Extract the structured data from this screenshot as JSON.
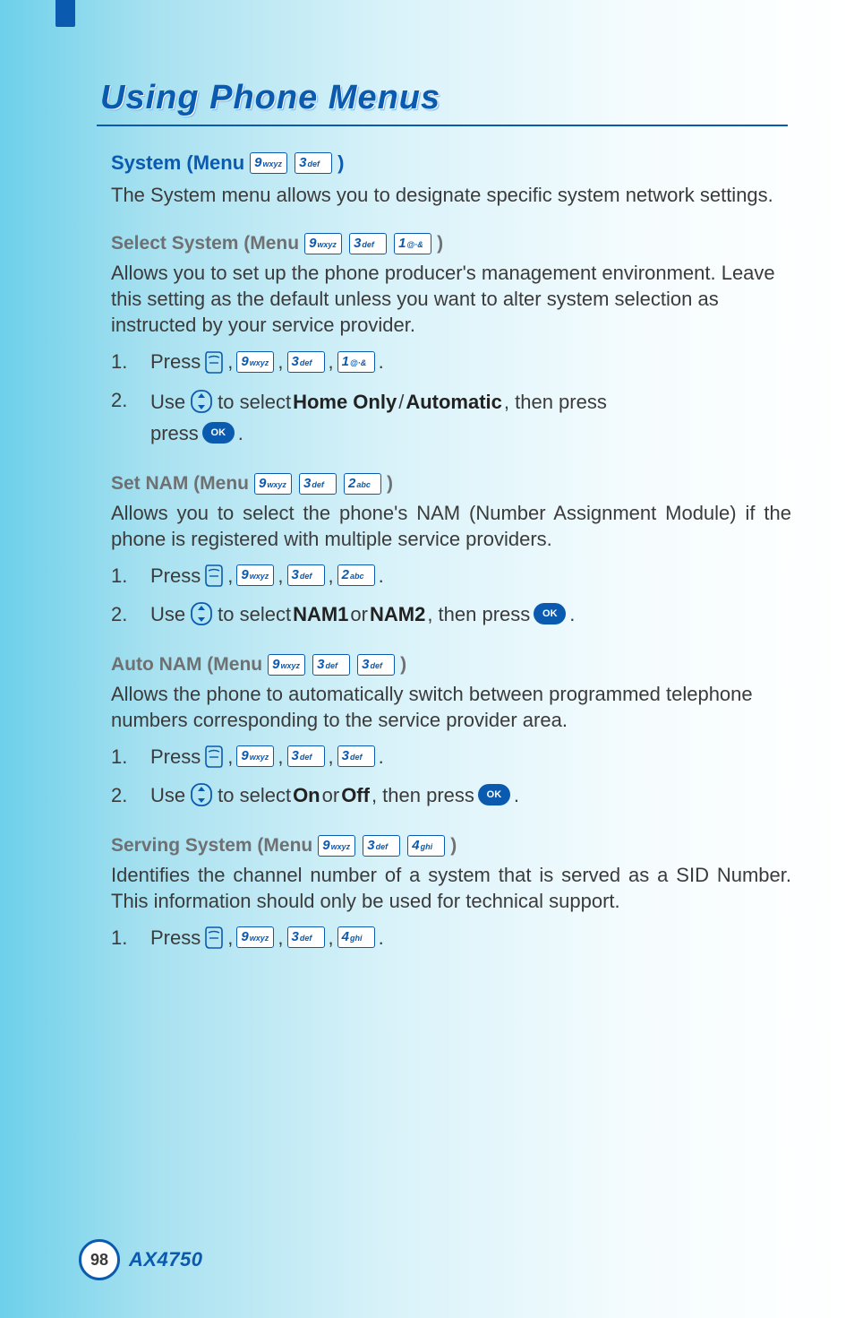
{
  "chapter_title": "Using Phone Menus",
  "keys": {
    "9": {
      "big": "9",
      "sm": "wxyz"
    },
    "3": {
      "big": "3",
      "sm": "def"
    },
    "1": {
      "big": "1",
      "sm": "@·&"
    },
    "2": {
      "big": "2",
      "sm": "abc"
    },
    "4": {
      "big": "4",
      "sm": "ghi"
    }
  },
  "ok_label": "OK",
  "sections": {
    "system": {
      "heading_prefix": "System (Menu ",
      "heading_suffix": ")",
      "description": "The System menu allows you to designate specific system network settings."
    },
    "select_system": {
      "heading_prefix": "Select System (Menu ",
      "heading_suffix": ")",
      "description": "Allows you to set up the phone producer's management environment. Leave this setting as the default unless you want to alter system selection as instructed by your service provider.",
      "step1_prefix": "Press ",
      "step2_prefix": "Use ",
      "step2_mid_a": " to select ",
      "step2_opt1": "Home Only",
      "step2_slash": "/ ",
      "step2_opt2": "Automatic",
      "step2_mid_b": ", then press ",
      "step_end": "."
    },
    "set_nam": {
      "heading_prefix": "Set NAM (Menu ",
      "heading_suffix": ")",
      "description": "Allows you to select the phone's NAM (Number Assignment Module) if the phone is registered with multiple service providers.",
      "step1_prefix": "Press ",
      "step2_prefix": "Use ",
      "step2_mid_a": " to select ",
      "step2_opt1": "NAM1",
      "step2_or": " or ",
      "step2_opt2": "NAM2",
      "step2_mid_b": ", then press ",
      "step_end": "."
    },
    "auto_nam": {
      "heading_prefix": "Auto NAM (Menu ",
      "heading_suffix": ")",
      "description": "Allows the phone to automatically switch between programmed telephone numbers corresponding to the service provider area.",
      "step1_prefix": "Press ",
      "step2_prefix": "Use ",
      "step2_mid_a": " to select ",
      "step2_opt1": "On",
      "step2_or": " or ",
      "step2_opt2": "Off",
      "step2_mid_b": ", then press ",
      "step_end": "."
    },
    "serving_system": {
      "heading_prefix": "Serving System (Menu ",
      "heading_suffix": ")",
      "description": "Identifies the channel number of a system that is served as a SID Number. This information should only be used for technical support.",
      "step1_prefix": "Press ",
      "step_end": "."
    }
  },
  "step_numbers": {
    "n1": "1.",
    "n2": "2."
  },
  "sep": " , ",
  "footer": {
    "page": "98",
    "model": "AX4750"
  }
}
